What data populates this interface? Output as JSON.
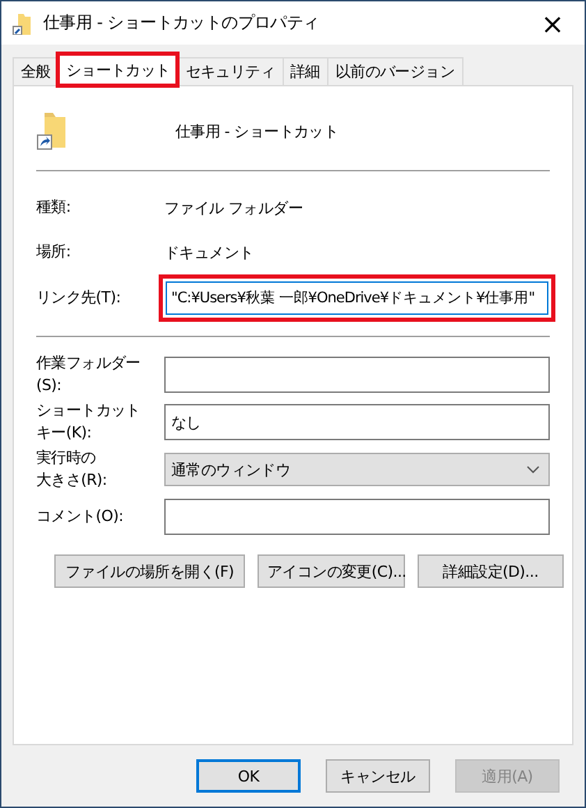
{
  "window": {
    "title": "仕事用 - ショートカットのプロパティ",
    "close": "×"
  },
  "tabs": [
    {
      "label": "全般",
      "selected": false,
      "highlighted": false
    },
    {
      "label": "ショートカット",
      "selected": true,
      "highlighted": true
    },
    {
      "label": "セキュリティ",
      "selected": false,
      "highlighted": false
    },
    {
      "label": "詳細",
      "selected": false,
      "highlighted": false
    },
    {
      "label": "以前のバージョン",
      "selected": false,
      "highlighted": false
    }
  ],
  "shortcut_name": "仕事用 - ショートカット",
  "info": [
    {
      "label": "種類:",
      "value": "ファイル フォルダー"
    },
    {
      "label": "場所:",
      "value": "ドキュメント"
    }
  ],
  "link": {
    "label": "リンク先(T):",
    "value": "\"C:¥Users¥秋葉 一郎¥OneDrive¥ドキュメント¥仕事用\"",
    "highlighted": true
  },
  "fields": [
    {
      "kind": "text",
      "label": [
        "作業フォルダー(S):"
      ]
    },
    {
      "kind": "text",
      "label": [
        "ショートカット",
        "キー(K):"
      ],
      "value": "なし"
    },
    {
      "kind": "select",
      "label": [
        "実行時の",
        "大きさ(R):"
      ],
      "value": "通常のウィンドウ"
    },
    {
      "kind": "text",
      "label": [
        "コメント(O):"
      ]
    }
  ],
  "actions": [
    "ファイルの場所を開く(F)",
    "アイコンの変更(C)...",
    "詳細設定(D)..."
  ],
  "buttons": [
    {
      "label": "OK",
      "default": true,
      "disabled": false
    },
    {
      "label": "キャンセル",
      "default": false,
      "disabled": false
    },
    {
      "label": "適用(A)",
      "default": false,
      "disabled": true
    }
  ]
}
